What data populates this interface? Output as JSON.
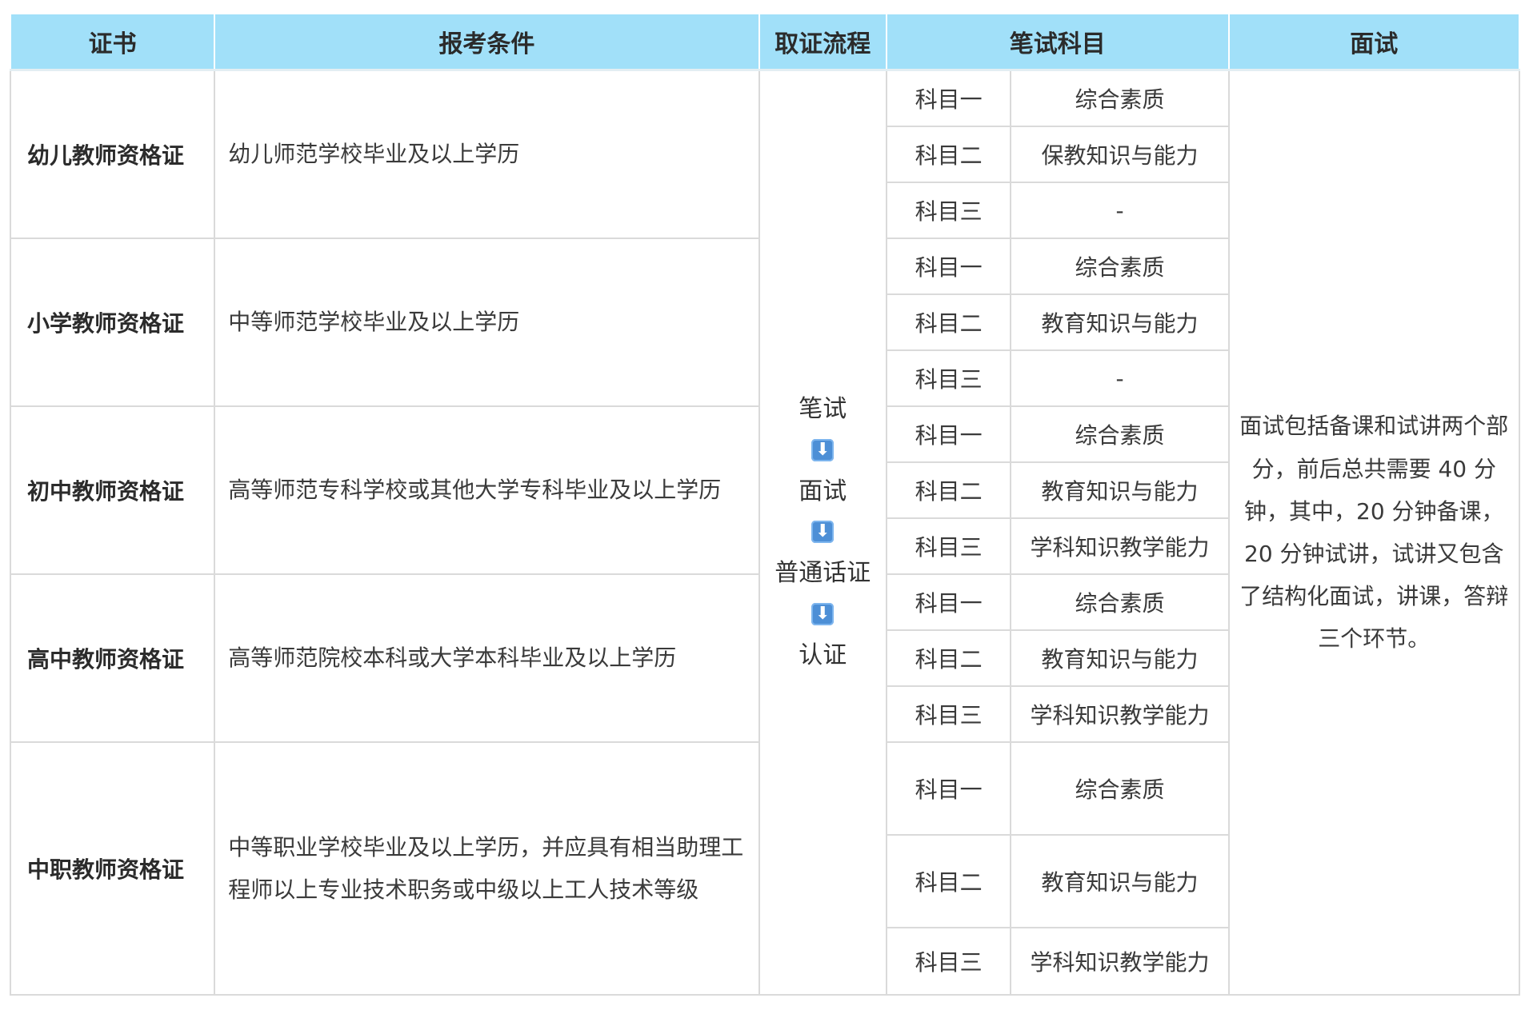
{
  "headers": {
    "cert": "证书",
    "condition": "报考条件",
    "process": "取证流程",
    "written": "笔试科目",
    "interview": "面试"
  },
  "certs": [
    {
      "name": "幼儿教师资格证",
      "condition": "幼儿师范学校毕业及以上学历",
      "subjects": [
        {
          "num": "科目一",
          "name": "综合素质"
        },
        {
          "num": "科目二",
          "name": "保教知识与能力"
        },
        {
          "num": "科目三",
          "name": "-"
        }
      ]
    },
    {
      "name": "小学教师资格证",
      "condition": "中等师范学校毕业及以上学历",
      "subjects": [
        {
          "num": "科目一",
          "name": "综合素质"
        },
        {
          "num": "科目二",
          "name": "教育知识与能力"
        },
        {
          "num": "科目三",
          "name": "-"
        }
      ]
    },
    {
      "name": "初中教师资格证",
      "condition": "高等师范专科学校或其他大学专科毕业及以上学历",
      "subjects": [
        {
          "num": "科目一",
          "name": "综合素质"
        },
        {
          "num": "科目二",
          "name": "教育知识与能力"
        },
        {
          "num": "科目三",
          "name": "学科知识教学能力"
        }
      ]
    },
    {
      "name": "高中教师资格证",
      "condition": "高等师范院校本科或大学本科毕业及以上学历",
      "subjects": [
        {
          "num": "科目一",
          "name": "综合素质"
        },
        {
          "num": "科目二",
          "name": "教育知识与能力"
        },
        {
          "num": "科目三",
          "name": "学科知识教学能力"
        }
      ]
    },
    {
      "name": "中职教师资格证",
      "condition": "中等职业学校毕业及以上学历，并应具有相当助理工程师以上专业技术职务或中级以上工人技术等级",
      "subjects": [
        {
          "num": "科目一",
          "name": "综合素质"
        },
        {
          "num": "科目二",
          "name": "教育知识与能力"
        },
        {
          "num": "科目三",
          "name": "学科知识教学能力"
        }
      ]
    }
  ],
  "process": {
    "steps": [
      "笔试",
      "面试",
      "普通话证",
      "认证"
    ],
    "arrow_icon": "down-arrow-icon",
    "arrow_color": "#4d8fd6"
  },
  "interview_text": "面试包括备课和试讲两个部分，前后总共需要 40 分钟，其中，20 分钟备课，20 分钟试讲，试讲又包含了结构化面试，讲课，答辩三个环节。",
  "colors": {
    "header_bg": "#a1e0f9",
    "border": "#dadada"
  }
}
